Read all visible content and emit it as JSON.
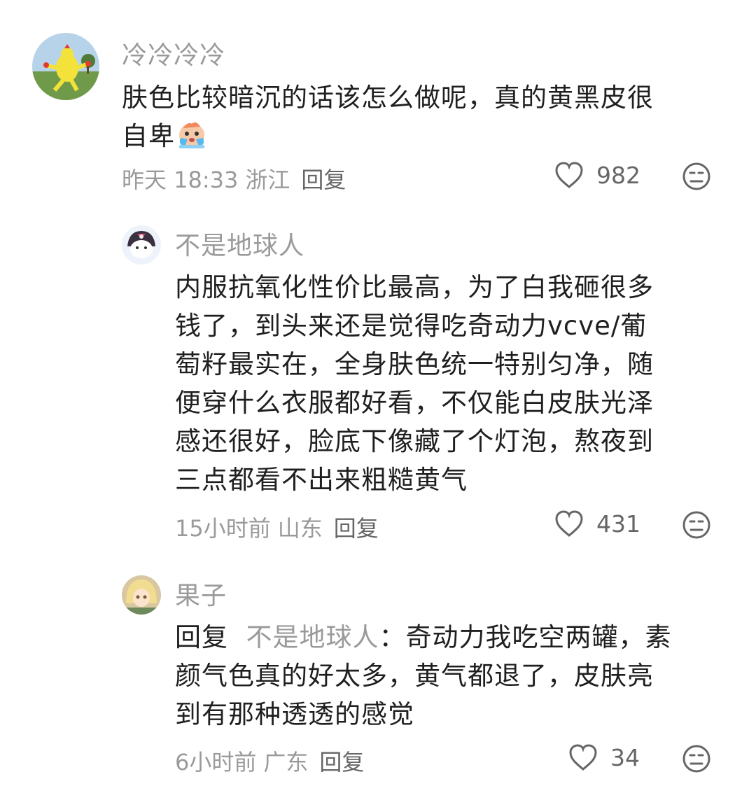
{
  "comments": [
    {
      "username": "冷冷冷冷",
      "lines": [
        "肤色比较暗沉的话该怎么做呢，真的黄黑皮很",
        "自卑"
      ],
      "emoji": "crying-face-emoji",
      "time": "昨天 18:33",
      "location": "浙江",
      "reply_label": "回复",
      "likes": "982"
    },
    {
      "username": "不是地球人",
      "lines": [
        "内服抗氧化性价比最高，为了白我砸很多",
        "钱了，到头来还是觉得吃奇动力vcve/葡",
        "萄籽最实在，全身肤色统一特别匀净，随",
        "便穿什么衣服都好看，不仅能白皮肤光泽",
        "感还很好，脸底下像藏了个灯泡，熬夜到",
        "三点都看不出来粗糙黄气"
      ],
      "time": "15小时前",
      "location": "山东",
      "reply_label": "回复",
      "likes": "431"
    },
    {
      "username": "果子",
      "reply_prefix": "回复",
      "reply_target": "不是地球人",
      "first_line_rest": "：奇动力我吃空两罐，素",
      "lines": [
        "颜气色真的好太多，黄气都退了，皮肤亮",
        "到有那种透透的感觉"
      ],
      "time": "6小时前",
      "location": "广东",
      "reply_label": "回复",
      "likes": "34"
    }
  ],
  "icons": {
    "like": "heart-outline-icon",
    "dislike": "meh-face-icon"
  }
}
